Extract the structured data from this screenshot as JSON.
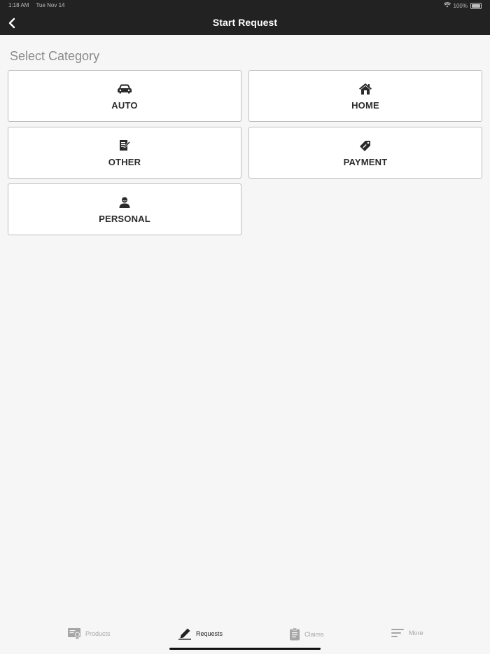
{
  "status_bar": {
    "time": "1:18 AM",
    "date": "Tue Nov 14",
    "battery": "100%"
  },
  "header": {
    "title": "Start Request"
  },
  "main": {
    "section_title": "Select Category",
    "categories": [
      {
        "label": "AUTO",
        "icon": "car-icon"
      },
      {
        "label": "HOME",
        "icon": "house-icon"
      },
      {
        "label": "OTHER",
        "icon": "document-pen-icon"
      },
      {
        "label": "PAYMENT",
        "icon": "payment-tag-icon"
      },
      {
        "label": "PERSONAL",
        "icon": "person-icon"
      }
    ]
  },
  "tabbar": {
    "tabs": [
      {
        "label": "Products",
        "icon": "products-icon",
        "active": false
      },
      {
        "label": "Requests",
        "icon": "pen-icon",
        "active": true
      },
      {
        "label": "Claims",
        "icon": "clipboard-icon",
        "active": false
      },
      {
        "label": "More",
        "icon": "menu-lines-icon",
        "active": false
      }
    ]
  },
  "colors": {
    "header_bg": "#222222",
    "page_bg": "#f6f6f6",
    "card_border": "#bdbdbd"
  }
}
